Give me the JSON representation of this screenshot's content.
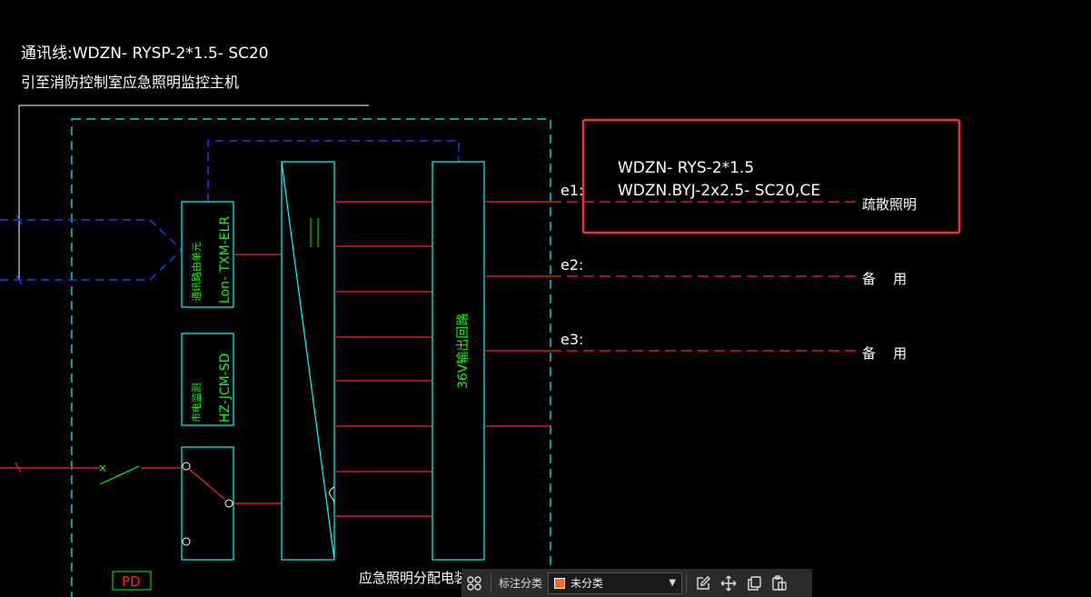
{
  "drawing": {
    "header_line1": "通讯线:WDZN- RYSP-2*1.5- SC20",
    "header_line2": "引至消防控制室应急照明监控主机",
    "module_comm": "通讯路由单元",
    "module_comm_model": "Lon- TXM-ELR",
    "module_power": "市电监测",
    "module_power_model": "HZ-JCM-SD",
    "output_module": "36V输出回路",
    "circuits": [
      {
        "id": "e1:",
        "load": "疏散照明"
      },
      {
        "id": "e2:",
        "load": "备    用"
      },
      {
        "id": "e3:",
        "load": "备    用"
      }
    ],
    "cable_spec_1": "WDZN- RYS-2*1.5",
    "cable_spec_2": "WDZN.BYJ-2x2.5- SC20,CE",
    "device_title": "应急照明分配电装置",
    "pd_tag": "PD",
    "colors": {
      "background": "#000000",
      "cyan": "#00ffff",
      "red": "#ff2020",
      "green": "#00ff00",
      "blue": "#1a3cff",
      "white": "#ffffff",
      "highlight": "#ff2a2a"
    }
  },
  "toolbar": {
    "group_icon": "grid-icon",
    "category_label": "标注分类",
    "category_value": "未分类",
    "category_color": "#ff6a1a",
    "icons": [
      "edit-icon",
      "move-icon",
      "copy-icon",
      "paste-icon"
    ]
  }
}
